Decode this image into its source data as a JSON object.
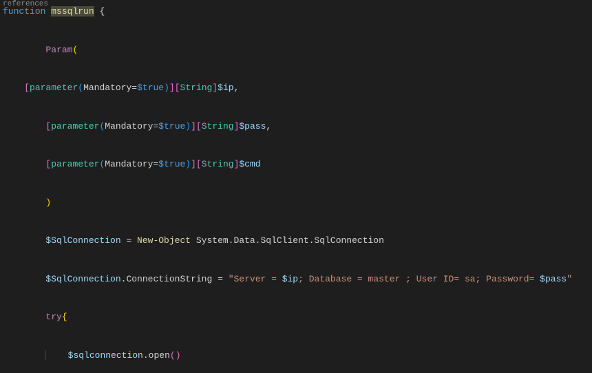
{
  "topLabel": "references",
  "line1": {
    "function": "function",
    "name": "mssqlrun",
    "brace": " {"
  },
  "paramKw": "Param",
  "paramOpen": "(",
  "p1": {
    "lb": "[",
    "attr": "parameter",
    "lp": "(",
    "prop": "Mandatory",
    "eq": "=",
    "val": "$true",
    "rp": ")",
    "rb": "]",
    "lb2": "[",
    "type": "String",
    "rb2": "]",
    "var": "$ip",
    "comma": ","
  },
  "p2": {
    "lb": "[",
    "attr": "parameter",
    "lp": "(",
    "prop": "Mandatory",
    "eq": "=",
    "val": "$true",
    "rp": ")",
    "rb": "]",
    "lb2": "[",
    "type": "String",
    "rb2": "]",
    "var": "$pass",
    "comma": ","
  },
  "p3": {
    "lb": "[",
    "attr": "parameter",
    "lp": "(",
    "prop": "Mandatory",
    "eq": "=",
    "val": "$true",
    "rp": ")",
    "rb": "]",
    "lb2": "[",
    "type": "String",
    "rb2": "]",
    "var": "$cmd"
  },
  "paramClose": ")",
  "conn1": {
    "var": "$SqlConnection",
    "eq": " = ",
    "cmd": "New-Object",
    "rest": " System.Data.SqlClient.SqlConnection"
  },
  "conn2": {
    "var": "$SqlConnection",
    "dot": ".",
    "member": "ConnectionString",
    "eq": " = ",
    "sq1": "\"Server = ",
    "sv1": "$ip",
    "sq2": "; Database = master ; User ID= sa; Password= ",
    "sv2": "$pass",
    "sq3": "\""
  },
  "tryKw": "try",
  "tryBrace": "{",
  "open1": {
    "var": "$sqlconnection",
    "dot": ".",
    "method": "open",
    "lp": "(",
    "rp": ")"
  }
}
